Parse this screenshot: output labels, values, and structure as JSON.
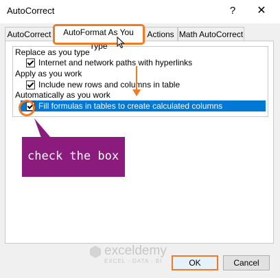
{
  "window": {
    "title": "AutoCorrect",
    "help_label": "?",
    "close_label": "✕"
  },
  "tabs": [
    {
      "label": "AutoCorrect"
    },
    {
      "label": "AutoFormat As You Type",
      "active": true
    },
    {
      "label": "Actions"
    },
    {
      "label": "Math AutoCorrect"
    }
  ],
  "sections": {
    "replace": {
      "heading": "Replace as you type",
      "option": {
        "label": "Internet and network paths with hyperlinks",
        "checked": true
      }
    },
    "apply": {
      "heading": "Apply as you work",
      "option": {
        "label": "Include new rows and columns in table",
        "checked": true
      }
    },
    "automatic": {
      "heading": "Automatically as you work",
      "option": {
        "label": "Fill formulas in tables to create calculated columns",
        "checked": true
      }
    }
  },
  "annotation": {
    "text": "check the box",
    "accent_color": "#f47920",
    "box_color": "#8b1c7e"
  },
  "watermark": {
    "name": "exceldemy",
    "tagline": "EXCEL · DATA · BI"
  },
  "buttons": {
    "ok": "OK",
    "cancel": "Cancel"
  },
  "colors": {
    "selection": "#0078d7",
    "dialog_bg": "#f0f0f0"
  },
  "icons": [
    "help-icon",
    "close-icon",
    "checkbox-checked-icon",
    "mouse-cursor-icon",
    "exceldemy-logo-icon"
  ]
}
